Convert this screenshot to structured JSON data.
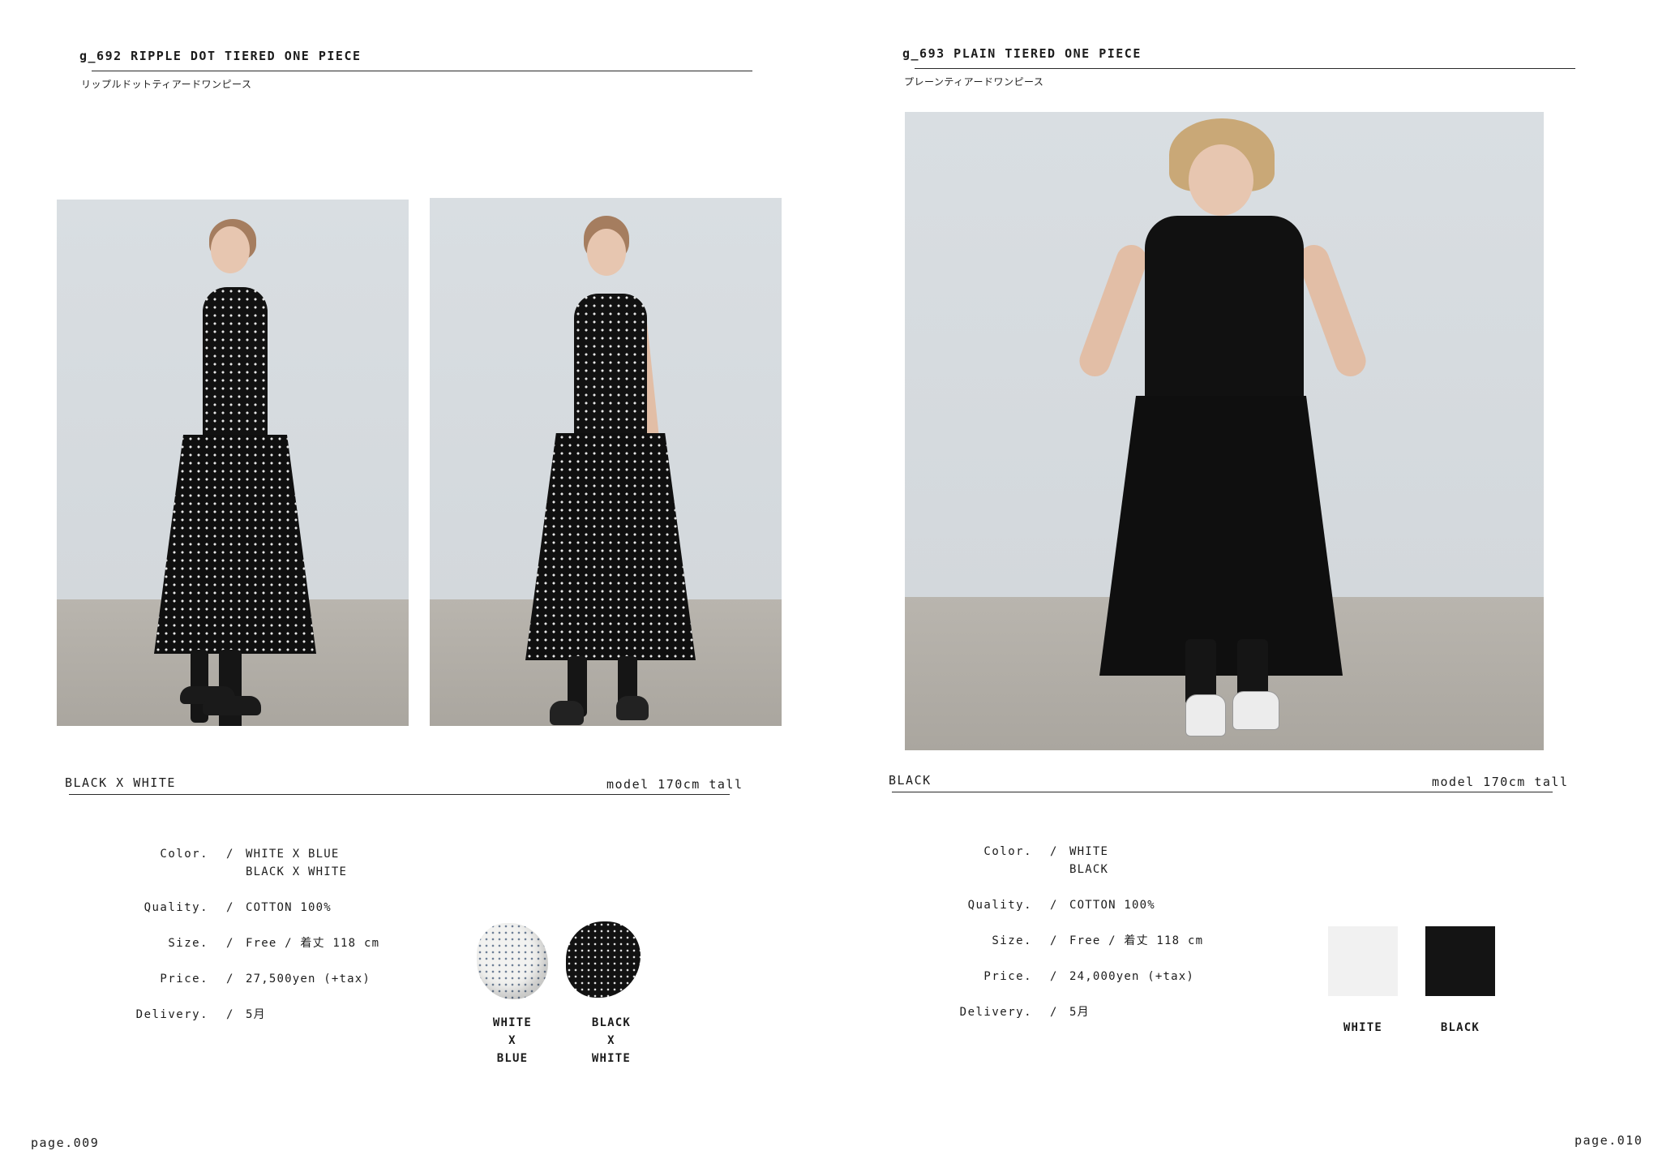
{
  "left": {
    "product_title": "g_692 RIPPLE DOT TIERED ONE PIECE",
    "product_subtitle": "リップルドットティアードワンピース",
    "caption_color": "BLACK X WHITE",
    "caption_model": "model 170cm tall",
    "specs": {
      "color_label": "Color.",
      "color_value_1": "WHITE X BLUE",
      "color_value_2": "BLACK X WHITE",
      "quality_label": "Quality.",
      "quality_value": "COTTON 100%",
      "size_label": "Size.",
      "size_value": "Free / 着丈 118 cm",
      "price_label": "Price.",
      "price_value": "27,500yen (+tax)",
      "delivery_label": "Delivery.",
      "delivery_value": "5月"
    },
    "swatches": [
      {
        "line1": "WHITE",
        "line2": "X",
        "line3": "BLUE",
        "color": "#f2f2f0"
      },
      {
        "line1": "BLACK",
        "line2": "X",
        "line3": "WHITE",
        "color": "#121212"
      }
    ],
    "page_number": "page.009"
  },
  "right": {
    "product_title": "g_693 PLAIN TIERED ONE PIECE",
    "product_subtitle": "プレーンティアードワンピース",
    "caption_color": "BLACK",
    "caption_model": "model 170cm tall",
    "specs": {
      "color_label": "Color.",
      "color_value_1": "WHITE",
      "color_value_2": "BLACK",
      "quality_label": "Quality.",
      "quality_value": "COTTON 100%",
      "size_label": "Size.",
      "size_value": "Free / 着丈 118 cm",
      "price_label": "Price.",
      "price_value": "24,000yen (+tax)",
      "delivery_label": "Delivery.",
      "delivery_value": "5月"
    },
    "swatches": [
      {
        "label": "WHITE",
        "color": "#f1f1f1"
      },
      {
        "label": "BLACK",
        "color": "#141414"
      }
    ],
    "page_number": "page.010"
  },
  "slash": "/"
}
